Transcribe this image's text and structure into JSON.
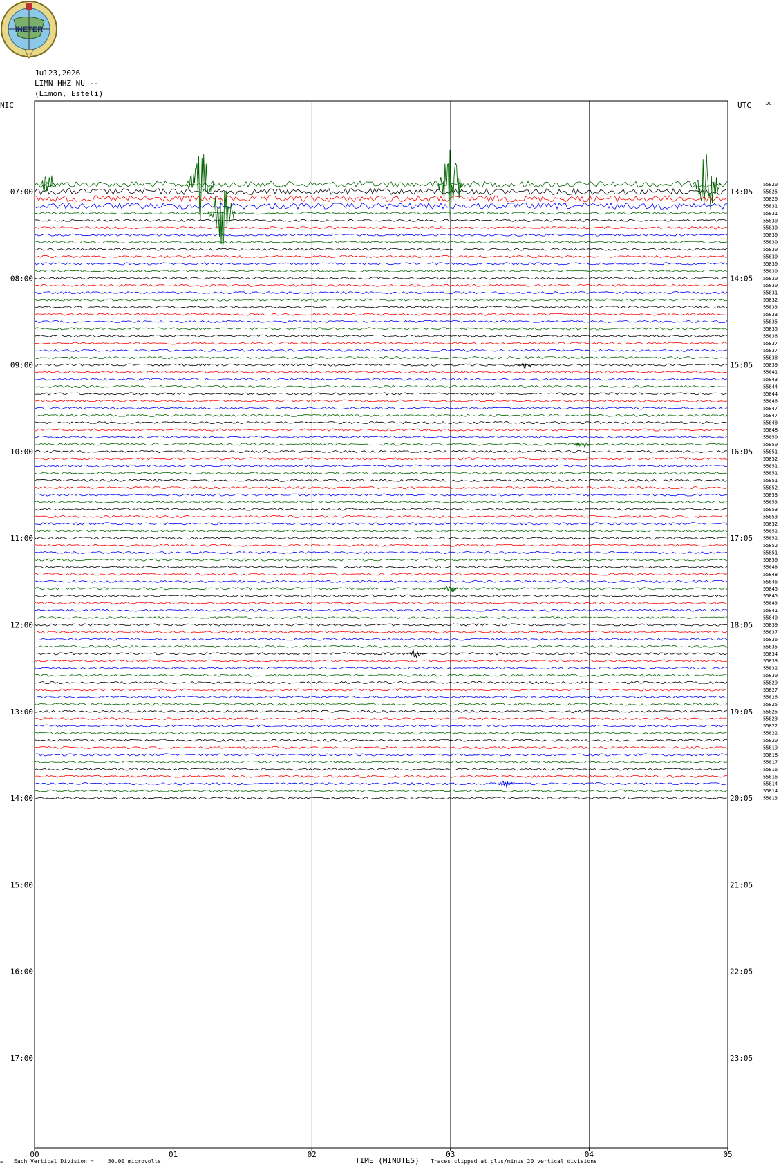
{
  "header": {
    "date": "Jul23,2026",
    "station": "LIMN HHZ NU --",
    "location": "(Limon, Esteli)",
    "left_tz": "NIC",
    "right_tz": "UTC",
    "dc_label": "DC",
    "logo_text": "INETER"
  },
  "footer": {
    "scale_note": "Each Vertical Division =",
    "scale_value": "50.00 microvolts",
    "xlabel": "TIME (MINUTES)",
    "clip_note": "Traces clipped at plus/minus 20 vertical divisions"
  },
  "colors": {
    "black": "#000000",
    "red": "#ff0000",
    "blue": "#0000ff",
    "green": "#006400",
    "grid": "#000000"
  },
  "chart_data": {
    "type": "line",
    "chart_kind": "helicorder",
    "xlim": [
      0,
      5
    ],
    "x_ticks": [
      "00",
      "01",
      "02",
      "03",
      "04",
      "05"
    ],
    "left_hour_labels": [
      "07:00",
      "08:00",
      "09:00",
      "10:00",
      "11:00",
      "12:00",
      "13:00",
      "14:00",
      "15:00",
      "16:00",
      "17:00"
    ],
    "right_hour_labels": [
      "13:05",
      "14:05",
      "15:05",
      "16:05",
      "17:05",
      "18:05",
      "19:05",
      "20:05",
      "21:05",
      "22:05",
      "23:05"
    ],
    "rows_per_hour": 12,
    "first_trace_row": 47,
    "color_cycle": [
      "black",
      "red",
      "blue",
      "green"
    ],
    "dc_counts": [
      "55820",
      "55825",
      "55820",
      "55831",
      "55831",
      "55830",
      "55830",
      "55830",
      "55830",
      "55830",
      "55830",
      "55830",
      "55830",
      "55830",
      "55830",
      "55831",
      "55832",
      "55833",
      "55833",
      "55835",
      "55835",
      "55836",
      "55837",
      "55837",
      "55838",
      "55839",
      "55841",
      "55843",
      "55844",
      "55844",
      "55846",
      "55847",
      "55847",
      "55848",
      "55848",
      "55850",
      "55850",
      "55851",
      "55852",
      "55851",
      "55851",
      "55851",
      "55852",
      "55853",
      "55853",
      "55853",
      "55853",
      "55852",
      "55852",
      "55852",
      "55852",
      "55851",
      "55850",
      "55848",
      "55848",
      "55846",
      "55845",
      "55845",
      "55843",
      "55841",
      "55840",
      "55839",
      "55837",
      "55836",
      "55835",
      "55834",
      "55833",
      "55832",
      "55830",
      "55829",
      "55827",
      "55826",
      "55825",
      "55825",
      "55823",
      "55822",
      "55822",
      "55820",
      "55819",
      "55818",
      "55817",
      "55816",
      "55816",
      "55814",
      "55814",
      "55813"
    ],
    "events": [
      {
        "row": 47,
        "minute": 0.1,
        "amplitude": "medium"
      },
      {
        "row": 47,
        "minute": 1.2,
        "amplitude": "large"
      },
      {
        "row": 47,
        "minute": 3.0,
        "amplitude": "large"
      },
      {
        "row": 47,
        "minute": 4.85,
        "amplitude": "large"
      },
      {
        "row": 51,
        "minute": 1.35,
        "amplitude": "large"
      },
      {
        "row": 72,
        "minute": 3.55,
        "amplitude": "small"
      },
      {
        "row": 83,
        "minute": 3.95,
        "amplitude": "small"
      },
      {
        "row": 103,
        "minute": 3.0,
        "amplitude": "small"
      },
      {
        "row": 112,
        "minute": 2.75,
        "amplitude": "small"
      },
      {
        "row": 130,
        "minute": 3.4,
        "amplitude": "small"
      }
    ]
  }
}
